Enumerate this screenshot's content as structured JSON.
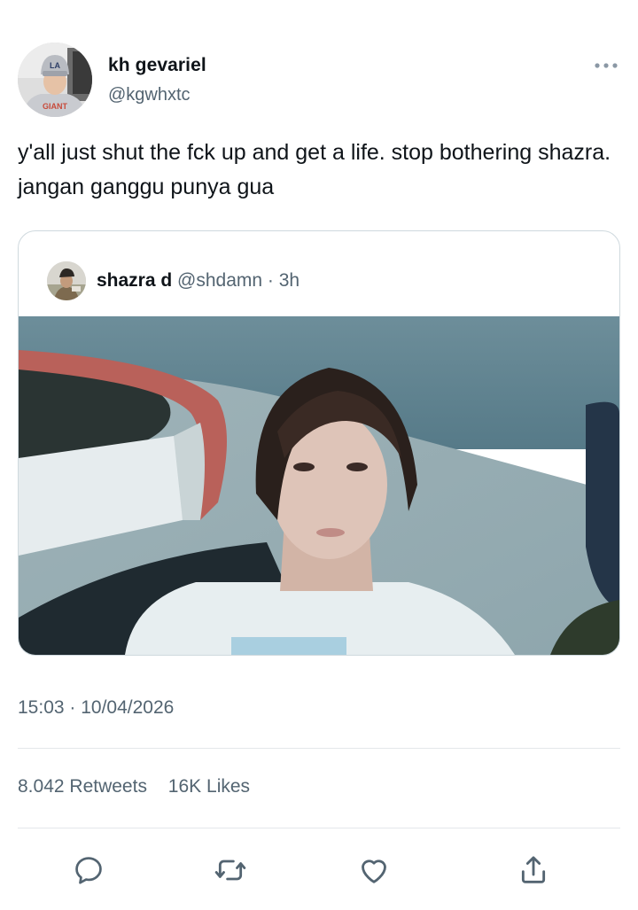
{
  "author": {
    "name": "kh gevariel",
    "handle": "@kgwhxtc",
    "avatar_cap_text": "LA",
    "avatar_shirt_text": "GIANT"
  },
  "tweet": {
    "text": "y'all just shut the fck up and get a life. stop bothering shazra. jangan ganggu punya gua",
    "timestamp": "15:03 · 10/04/2026"
  },
  "quote": {
    "name": "shazra d",
    "meta": "@shdamn · 3h"
  },
  "stats": {
    "retweets_count": "8.042",
    "retweets_label": "Retweets",
    "likes_count": "16K",
    "likes_label": "Likes"
  },
  "icons": {
    "more": "more-horizontal-icon",
    "reply": "reply-icon",
    "retweet": "retweet-icon",
    "like": "heart-icon",
    "share": "share-icon"
  },
  "colors": {
    "text_primary": "#0f1419",
    "text_secondary": "#536471",
    "border": "#cfd9de",
    "icon": "#536471"
  }
}
